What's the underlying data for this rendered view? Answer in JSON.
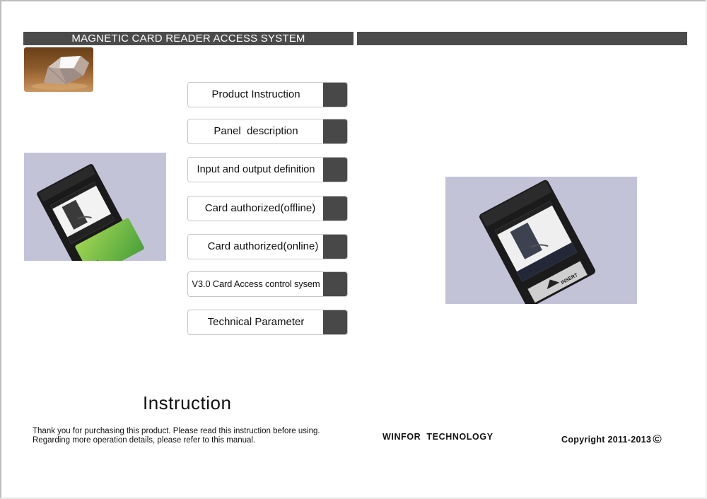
{
  "header": {
    "title": "MAGNETIC CARD READER ACCESS SYSTEM",
    "right_bar_text": ""
  },
  "images": {
    "thumbnail": "diamond-photo",
    "left_photo": "card-reader-with-inserted-card-photo",
    "right_photo": "card-reader-photo",
    "right_photo_label": "INSERT"
  },
  "menu": {
    "items": [
      {
        "label": "Product Instruction"
      },
      {
        "label": "Panel  description"
      },
      {
        "label": "Input and output definition"
      },
      {
        "label": "Card authorized(offline)"
      },
      {
        "label": "Card authorized(online)"
      },
      {
        "label": "V3.0 Card Access control sysem"
      },
      {
        "label": "Technical Parameter"
      }
    ]
  },
  "footer": {
    "title": "Instruction",
    "intro_line1": "Thank you for purchasing this product. Please read this instruction before using.",
    "intro_line2": "Regarding more operation details, please refer to this manual.",
    "company": "WINFOR  TECHNOLOGY",
    "copyright": "Copyright 2011-2013",
    "copyright_symbol": "©"
  },
  "colors": {
    "header_bar": "#4b4b4b",
    "menu_tab": "#484848",
    "photo_background": "#c3c3d8"
  }
}
